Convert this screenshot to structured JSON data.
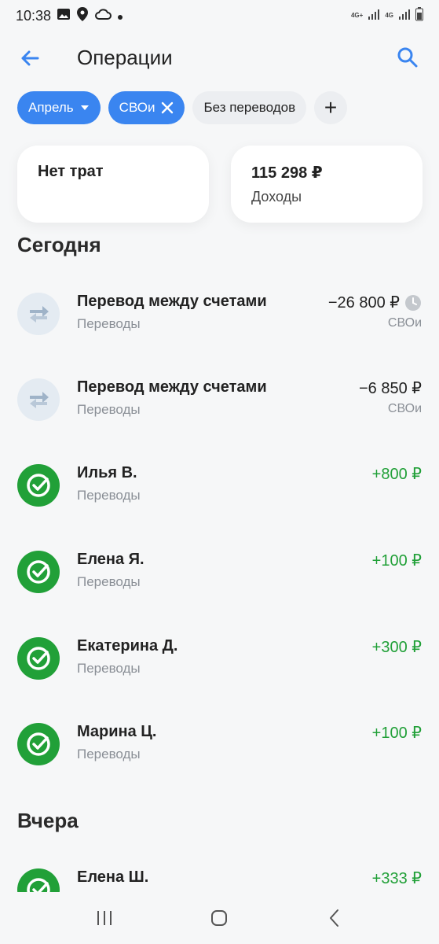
{
  "status_bar": {
    "time": "10:38",
    "net1": "4G+",
    "net2": "4G"
  },
  "header": {
    "title": "Операции"
  },
  "filters": {
    "month": "Апрель",
    "account": "СВОи",
    "transfers": "Без переводов",
    "add": "+"
  },
  "summary": {
    "expenses": {
      "amount": "Нет трат"
    },
    "income": {
      "amount": "115 298 ₽",
      "label": "Доходы"
    }
  },
  "sections": {
    "today": "Сегодня",
    "yesterday": "Вчера"
  },
  "operations": [
    {
      "name": "Перевод между счетами",
      "category": "Переводы",
      "amount": "−26 800 ₽",
      "sub": "СВОи",
      "icon": "transfer-arrows-icon",
      "pending": true
    },
    {
      "name": "Перевод между счетами",
      "category": "Переводы",
      "amount": "−6 850 ₽",
      "sub": "СВОи",
      "icon": "transfer-arrows-icon",
      "pending": false
    },
    {
      "name": "Илья В.",
      "category": "Переводы",
      "amount": "+800 ₽",
      "sub": "",
      "icon": "sber-logo-icon"
    },
    {
      "name": "Елена Я.",
      "category": "Переводы",
      "amount": "+100 ₽",
      "sub": "",
      "icon": "sber-logo-icon"
    },
    {
      "name": "Екатерина Д.",
      "category": "Переводы",
      "amount": "+300 ₽",
      "sub": "",
      "icon": "sber-logo-icon"
    },
    {
      "name": "Марина Ц.",
      "category": "Переводы",
      "amount": "+100 ₽",
      "sub": "",
      "icon": "sber-logo-icon"
    },
    {
      "name": "Елена Ш.",
      "category": "",
      "amount": "+333 ₽",
      "sub": "",
      "icon": "sber-logo-icon"
    }
  ],
  "colors": {
    "accent": "#3a85f0",
    "positive": "#21a038",
    "muted": "#8a8f96"
  }
}
